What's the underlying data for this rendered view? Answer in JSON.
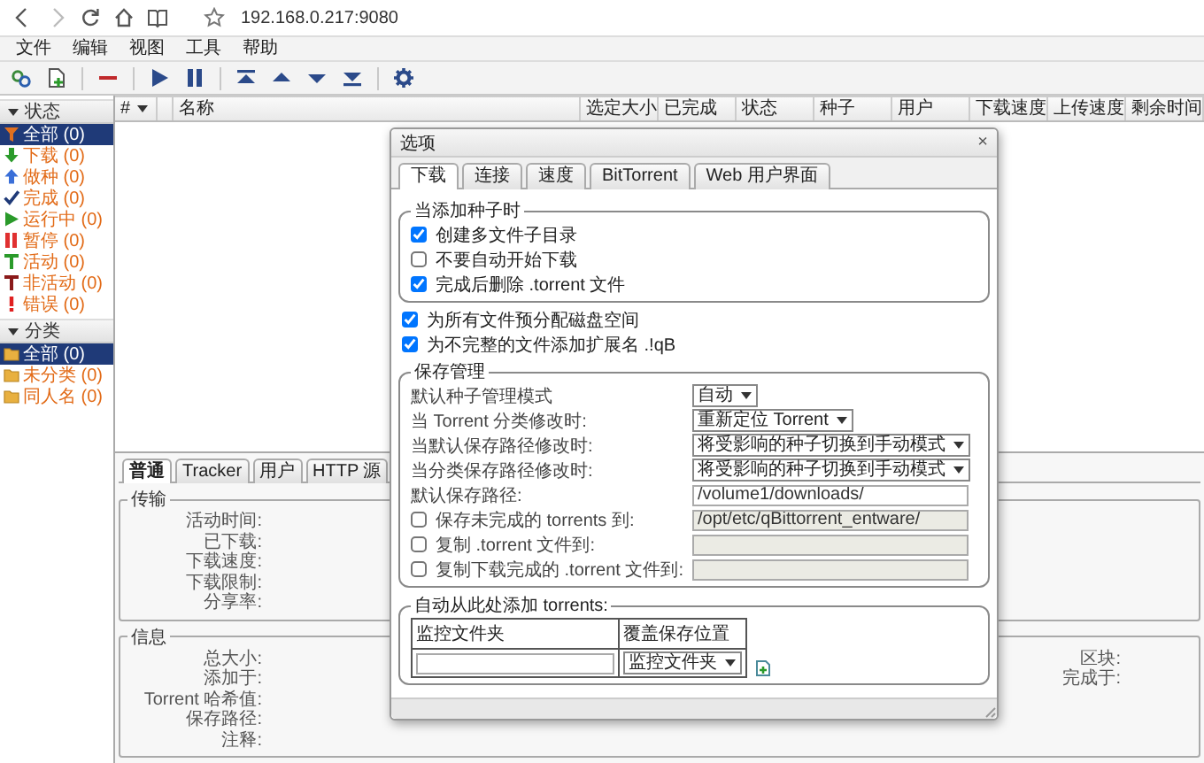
{
  "browser": {
    "url": "192.168.0.217:9080"
  },
  "menu": [
    "文件",
    "编辑",
    "视图",
    "工具",
    "帮助"
  ],
  "toolbar": [
    {
      "kind": "add_link"
    },
    {
      "kind": "add_file"
    },
    {
      "kind": "separator"
    },
    {
      "kind": "remove"
    },
    {
      "kind": "separator"
    },
    {
      "kind": "resume"
    },
    {
      "kind": "pause"
    },
    {
      "kind": "separator"
    },
    {
      "kind": "top"
    },
    {
      "kind": "up"
    },
    {
      "kind": "down"
    },
    {
      "kind": "bottom"
    },
    {
      "kind": "separator"
    },
    {
      "kind": "settings"
    }
  ],
  "sidebar": {
    "sections": [
      {
        "title": "状态",
        "expanded": true,
        "items": [
          {
            "label": "全部 (0)",
            "kind": "filter",
            "selected": true
          },
          {
            "label": "下载 (0)",
            "kind": "download",
            "selected": false
          },
          {
            "label": "做种 (0)",
            "kind": "upload",
            "selected": false
          },
          {
            "label": "完成 (0)",
            "kind": "complete",
            "selected": false
          },
          {
            "label": "运行中 (0)",
            "kind": "running",
            "selected": false
          },
          {
            "label": "暂停 (0)",
            "kind": "paused",
            "selected": false
          },
          {
            "label": "活动 (0)",
            "kind": "active",
            "selected": false
          },
          {
            "label": "非活动 (0)",
            "kind": "inactive",
            "selected": false
          },
          {
            "label": "错误 (0)",
            "kind": "error",
            "selected": false
          }
        ]
      },
      {
        "title": "分类",
        "expanded": true,
        "items": [
          {
            "label": "全部 (0)",
            "kind": "folder",
            "selected": true
          },
          {
            "label": "未分类 (0)",
            "kind": "folder",
            "selected": false
          },
          {
            "label": "同人名 (0)",
            "kind": "folder",
            "selected": false
          }
        ]
      }
    ]
  },
  "table": {
    "columns": [
      "#",
      "名称",
      "选定大小",
      "已完成",
      "状态",
      "种子",
      "用户",
      "下载速度",
      "上传速度",
      "剩余时间"
    ]
  },
  "details": {
    "tabs": [
      {
        "label": "普通",
        "selected": true
      },
      {
        "label": "Tracker",
        "selected": false
      },
      {
        "label": "用户",
        "selected": false
      },
      {
        "label": "HTTP 源",
        "selected": false
      }
    ],
    "groups": [
      {
        "title": "传输",
        "fields": [
          "活动时间:",
          "已下载:",
          "下载速度:",
          "下载限制:",
          "分享率:"
        ]
      },
      {
        "title": "信息",
        "fields": [
          "总大小:",
          "添加于:",
          "Torrent 哈希值:",
          "保存路径:",
          "注释:"
        ],
        "fields_right": [
          "区块:",
          "完成于:"
        ]
      }
    ]
  },
  "dialog": {
    "title": "选项",
    "close": "×",
    "tabs": [
      {
        "label": "下载",
        "selected": true
      },
      {
        "label": "连接",
        "selected": false
      },
      {
        "label": "速度",
        "selected": false
      },
      {
        "label": "BitTorrent",
        "selected": false
      },
      {
        "label": "Web 用户界面",
        "selected": false
      }
    ],
    "sections": [
      {
        "kind": "group",
        "title": "当添加种子时",
        "rows": [
          {
            "kind": "check",
            "label": "创建多文件子目录",
            "checked": true
          },
          {
            "kind": "check",
            "label": "不要自动开始下载",
            "checked": false
          },
          {
            "kind": "check",
            "label": "完成后删除 .torrent 文件",
            "checked": true
          }
        ]
      },
      {
        "kind": "check",
        "label": "为所有文件预分配磁盘空间",
        "checked": true
      },
      {
        "kind": "check",
        "label": "为不完整的文件添加扩展名 .!qB",
        "checked": true
      },
      {
        "kind": "group",
        "title": "保存管理",
        "rows": [
          {
            "kind": "select",
            "label": "默认种子管理模式",
            "value": "自动"
          },
          {
            "kind": "select",
            "label": "当 Torrent 分类修改时:",
            "value": "重新定位 Torrent"
          },
          {
            "kind": "select",
            "label": "当默认保存路径修改时:",
            "value": "将受影响的种子切换到手动模式"
          },
          {
            "kind": "select",
            "label": "当分类保存路径修改时:",
            "value": "将受影响的种子切换到手动模式"
          },
          {
            "kind": "path",
            "label": "默认保存路径:",
            "value": "/volume1/downloads/"
          },
          {
            "kind": "check_path",
            "label": "保存未完成的 torrents 到:",
            "checked": false,
            "disabled": true,
            "value": "/opt/etc/qBittorrent_entware/"
          },
          {
            "kind": "check_path",
            "label": "复制 .torrent 文件到:",
            "checked": false,
            "disabled": true
          },
          {
            "kind": "check_path",
            "label": "复制下载完成的 .torrent 文件到:",
            "checked": false,
            "disabled": true
          }
        ]
      },
      {
        "kind": "watch",
        "title": "自动从此处添加 torrents:",
        "columns": [
          "监控文件夹",
          "覆盖保存位置"
        ],
        "select": "监控文件夹"
      }
    ]
  }
}
